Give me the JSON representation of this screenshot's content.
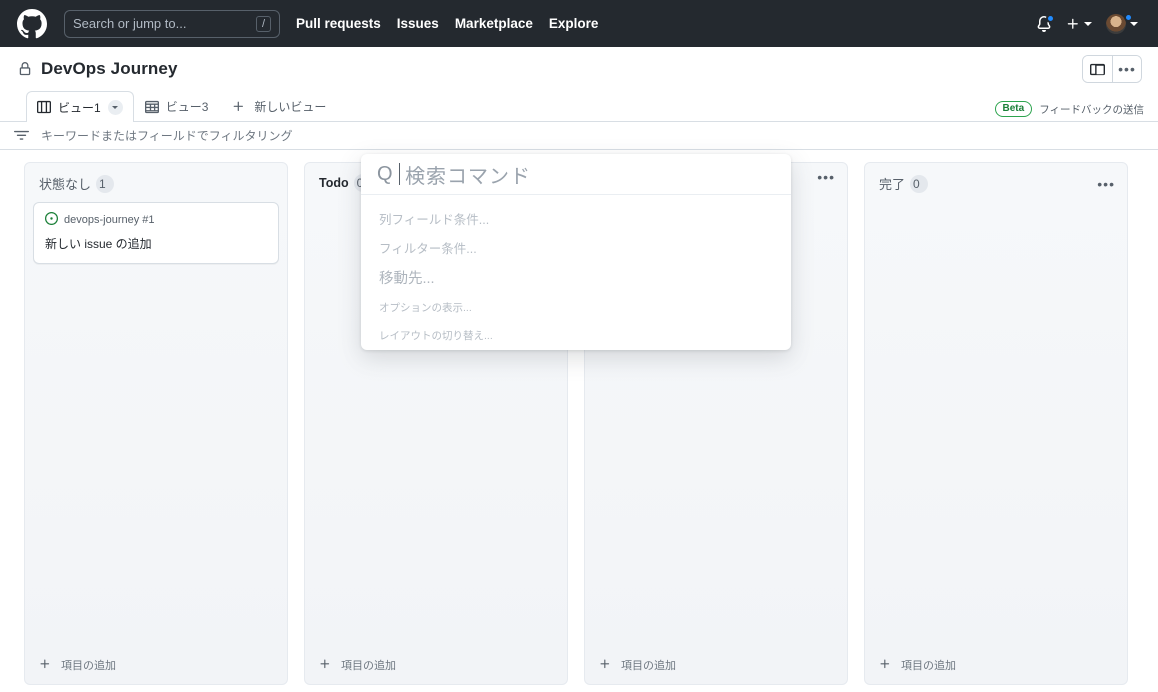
{
  "header": {
    "logo": "github-mark-icon",
    "search": {
      "placeholder": "Search or jump to...",
      "shortcut": "/"
    },
    "nav": [
      {
        "label": "Pull requests"
      },
      {
        "label": "Issues"
      },
      {
        "label": "Marketplace"
      },
      {
        "label": "Explore"
      }
    ],
    "notifications_icon": "bell-icon",
    "create_new_icon": "plus-icon",
    "avatar_icon": "user-avatar"
  },
  "project": {
    "visibility_icon": "lock-icon",
    "title": "DevOps Journey",
    "actions": {
      "sidebar_toggle_icon": "sidebar-expand-icon",
      "more_label": "•••"
    }
  },
  "tabs": {
    "items": [
      {
        "label": "ビュー1",
        "icon": "board-view-icon",
        "active": true,
        "has_menu": true
      },
      {
        "label": "ビュー3",
        "icon": "table-view-icon",
        "active": false,
        "has_menu": false
      }
    ],
    "new_view_label": "新しいビュー",
    "new_view_icon": "plus-icon",
    "beta_badge": "Beta",
    "feedback_label": "フィードバックの送信"
  },
  "filter_bar": {
    "icon": "filter-icon",
    "placeholder": "キーワードまたはフィールドでフィルタリング"
  },
  "board": {
    "columns": [
      {
        "title": "状態なし",
        "count": "1",
        "bold": false,
        "show_kebab": false,
        "add_item_label": "項目の追加",
        "cards": [
          {
            "repo": "devops-journey #1",
            "title": "新しい issue の追加",
            "status_icon": "issue-opened-icon"
          }
        ]
      },
      {
        "title": "Todo",
        "count": "0",
        "bold": true,
        "show_kebab": false,
        "add_item_label": "項目の追加",
        "cards": []
      },
      {
        "title": "",
        "count": "",
        "bold": false,
        "show_kebab": true,
        "add_item_label": "項目の追加",
        "cards": []
      },
      {
        "title": "完了",
        "count": "0",
        "bold": false,
        "show_kebab": true,
        "add_item_label": "項目の追加",
        "cards": []
      }
    ]
  },
  "command_palette": {
    "search_icon_letter": "Q",
    "placeholder": "検索コマンド",
    "items": [
      {
        "label": "列フィールド条件..."
      },
      {
        "label": "フィルター条件..."
      },
      {
        "label": "移動先..."
      },
      {
        "label": "オプションの表示..."
      },
      {
        "label": "レイアウトの切り替え..."
      }
    ]
  },
  "colors": {
    "header_bg": "#24292f",
    "accent_blue": "#218bff",
    "beta_green": "#2da44e",
    "issue_green": "#1a7f37",
    "column_bg": "#f6f8fa"
  }
}
